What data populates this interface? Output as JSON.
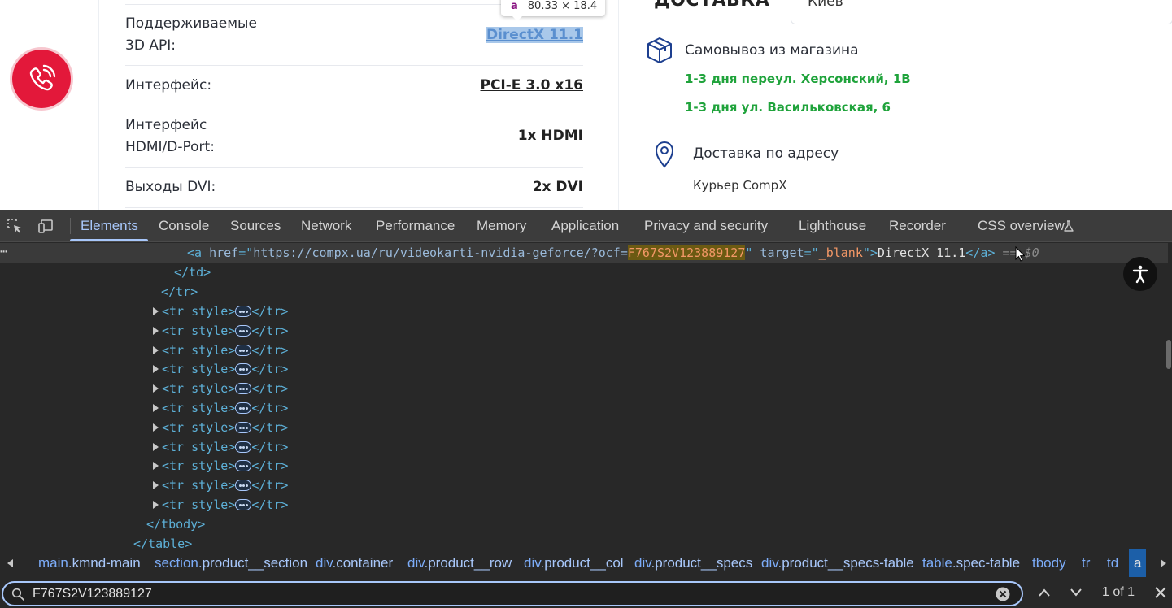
{
  "page": {
    "specs": [
      {
        "label": "Поддерживаемые 3D API:",
        "value": "DirectX 11.1"
      },
      {
        "label": "Интерфейс:",
        "value": "PCI-E 3.0 x16"
      },
      {
        "label": "Интерфейс HDMI/D-Port:",
        "value": "1x HDMI"
      },
      {
        "label": "Выходы DVI:",
        "value": "2x DVI"
      }
    ],
    "spec_labels_split": {
      "row0_line1": "Поддерживаемые",
      "row0_line2": "3D API:",
      "row2_line1": "Интерфейс",
      "row2_line2": "HDMI/D-Port:"
    },
    "tooltip": {
      "tag": "a",
      "size": "80.33 × 18.4"
    },
    "delivery": {
      "title": "ДОСТАВКА",
      "city": "Киев",
      "pickup_title": "Самовывоз из магазина",
      "pickup_options": [
        "1-3 дня переул. Херсонский, 1В",
        "1-3 дня ул. Васильковская, 6"
      ],
      "address_title": "Доставка по адресу",
      "courier": "Курьер CompX"
    }
  },
  "devtools": {
    "tabs": [
      "Elements",
      "Console",
      "Sources",
      "Network",
      "Performance",
      "Memory",
      "Application",
      "Privacy and security",
      "Lighthouse",
      "Recorder",
      "CSS overview"
    ],
    "active_tab": "Elements",
    "selected_line": {
      "tag_open": "<a",
      "href_attr": "href",
      "href_prefix": "https://compx.ua/ru/videokarti-nvidia-geforce/?ocf=",
      "href_match": "F767S2V123889127",
      "target_attr": "target",
      "target_value": "_blank",
      "text": "DirectX 11.1",
      "tag_close": "</a>",
      "eq": "==",
      "ref": "$0"
    },
    "lines": {
      "td_close": "</td>",
      "tr_close": "</tr>",
      "tr_collapsed_open": "<tr style>",
      "tbody_close": "</tbody>",
      "table_close": "</table>"
    },
    "collapsed_rows_count": 11,
    "breadcrumbs": [
      {
        "tag": "main",
        "cls": ".kmnd-main"
      },
      {
        "tag": "section",
        "cls": ".product__section"
      },
      {
        "tag": "div",
        "cls": ".container"
      },
      {
        "tag": "div",
        "cls": ".product__row"
      },
      {
        "tag": "div",
        "cls": ".product__col"
      },
      {
        "tag": "div",
        "cls": ".product__specs"
      },
      {
        "tag": "div",
        "cls": ".product__specs-table"
      },
      {
        "tag": "table",
        "cls": ".spec-table"
      },
      {
        "tag": "tbody",
        "cls": ""
      },
      {
        "tag": "tr",
        "cls": ""
      },
      {
        "tag": "td",
        "cls": ""
      },
      {
        "tag": "a",
        "cls": ""
      }
    ],
    "search": {
      "value": "F767S2V123889127",
      "count": "1 of 1"
    }
  }
}
